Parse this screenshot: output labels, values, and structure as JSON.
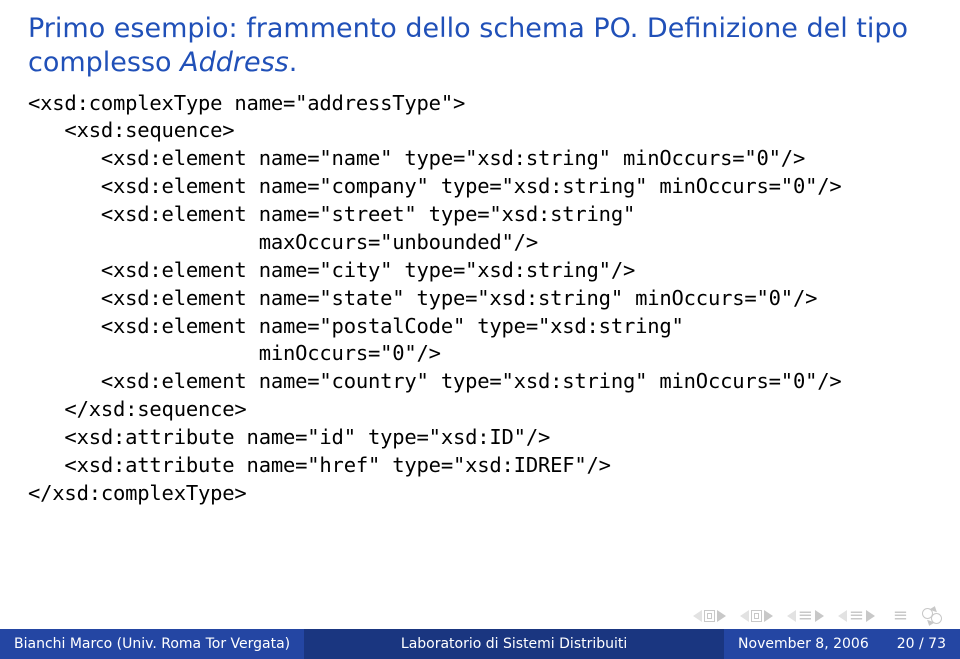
{
  "title_plain": "Primo esempio: frammento dello schema PO. Definizione del tipo complesso ",
  "title_italic": "Address",
  "title_end": ".",
  "code": "<xsd:complexType name=\"addressType\">\n   <xsd:sequence>\n      <xsd:element name=\"name\" type=\"xsd:string\" minOccurs=\"0\"/>\n      <xsd:element name=\"company\" type=\"xsd:string\" minOccurs=\"0\"/>\n      <xsd:element name=\"street\" type=\"xsd:string\"\n                   maxOccurs=\"unbounded\"/>\n      <xsd:element name=\"city\" type=\"xsd:string\"/>\n      <xsd:element name=\"state\" type=\"xsd:string\" minOccurs=\"0\"/>\n      <xsd:element name=\"postalCode\" type=\"xsd:string\"\n                   minOccurs=\"0\"/>\n      <xsd:element name=\"country\" type=\"xsd:string\" minOccurs=\"0\"/>\n   </xsd:sequence>\n   <xsd:attribute name=\"id\" type=\"xsd:ID\"/>\n   <xsd:attribute name=\"href\" type=\"xsd:IDREF\"/>\n</xsd:complexType>",
  "footer": {
    "author": "Bianchi Marco (Univ. Roma Tor Vergata)",
    "talk": "Laboratorio di Sistemi Distribuiti",
    "date": "November 8, 2006",
    "page": "20 / 73"
  }
}
